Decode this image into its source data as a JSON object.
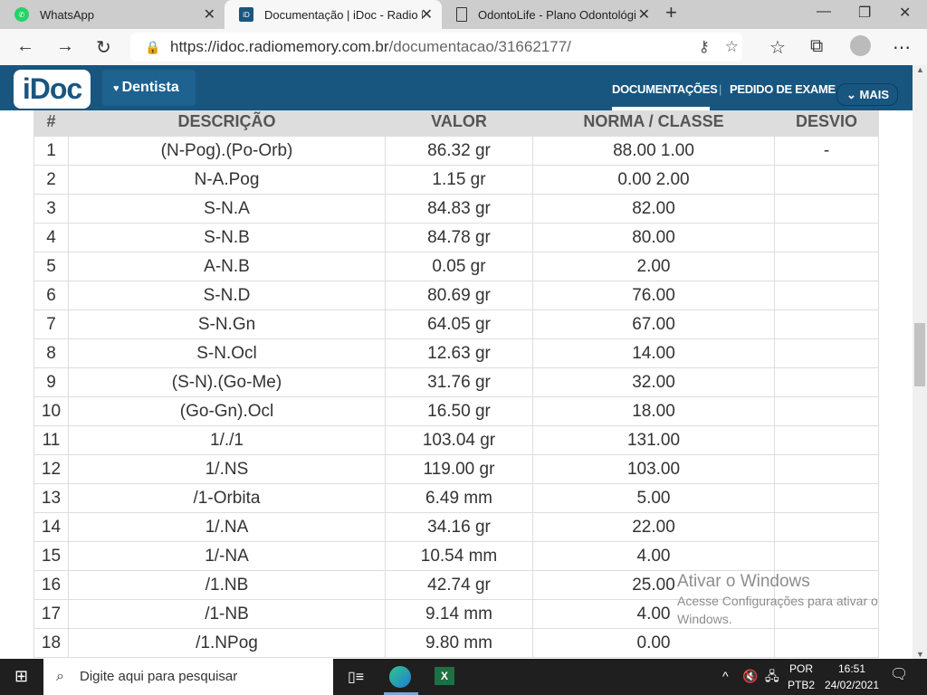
{
  "browser": {
    "tabs": [
      {
        "title": "WhatsApp",
        "icon": "whatsapp-icon"
      },
      {
        "title": "Documentação | iDoc - Radio Memory",
        "icon": "idoc-icon",
        "active": true
      },
      {
        "title": "OdontoLife - Plano Odontológico",
        "icon": "page-icon"
      }
    ],
    "url_host": "https://idoc.radiomemory.com.br",
    "url_path": "/documentacao/31662177/"
  },
  "site": {
    "logo": "iDoc",
    "dentist": "Dentista",
    "menu": [
      "DOCUMENTAÇÕES",
      "PEDIDO DE EXAME",
      "MAIS"
    ],
    "active_menu": "DOCUMENTAÇÕES",
    "brand_color": "#185680"
  },
  "table": {
    "headers": [
      "#",
      "DESCRIÇÃO",
      "VALOR",
      "NORMA / CLASSE",
      "DESVIO"
    ],
    "rows": [
      [
        "1",
        "(N-Pog).(Po-Orb)",
        "86.32 gr",
        "88.00 1.00",
        "-"
      ],
      [
        "2",
        "N-A.Pog",
        "1.15 gr",
        "0.00 2.00",
        ""
      ],
      [
        "3",
        "S-N.A",
        "84.83 gr",
        "82.00",
        ""
      ],
      [
        "4",
        "S-N.B",
        "84.78 gr",
        "80.00",
        ""
      ],
      [
        "5",
        "A-N.B",
        "0.05 gr",
        "2.00",
        ""
      ],
      [
        "6",
        "S-N.D",
        "80.69 gr",
        "76.00",
        ""
      ],
      [
        "7",
        "S-N.Gn",
        "64.05 gr",
        "67.00",
        ""
      ],
      [
        "8",
        "S-N.Ocl",
        "12.63 gr",
        "14.00",
        ""
      ],
      [
        "9",
        "(S-N).(Go-Me)",
        "31.76 gr",
        "32.00",
        ""
      ],
      [
        "10",
        "(Go-Gn).Ocl",
        "16.50 gr",
        "18.00",
        ""
      ],
      [
        "11",
        "1/./1",
        "103.04 gr",
        "131.00",
        ""
      ],
      [
        "12",
        "1/.NS",
        "119.00 gr",
        "103.00",
        ""
      ],
      [
        "13",
        "/1-Orbita",
        "6.49 mm",
        "5.00",
        ""
      ],
      [
        "14",
        "1/.NA",
        "34.16 gr",
        "22.00",
        ""
      ],
      [
        "15",
        "1/-NA",
        "10.54 mm",
        "4.00",
        ""
      ],
      [
        "16",
        "/1.NB",
        "42.74 gr",
        "25.00",
        ""
      ],
      [
        "17",
        "/1-NB",
        "9.14 mm",
        "4.00",
        ""
      ],
      [
        "18",
        "/1.NPog",
        "9.80 mm",
        "0.00",
        ""
      ]
    ]
  },
  "watermark": {
    "title": "Ativar o Windows",
    "text": "Acesse Configurações para ativar o Windows."
  },
  "taskbar": {
    "search_placeholder": "Digite aqui para pesquisar",
    "lang1": "POR",
    "lang2": "PTB2",
    "time": "16:51",
    "date": "24/02/2021"
  }
}
